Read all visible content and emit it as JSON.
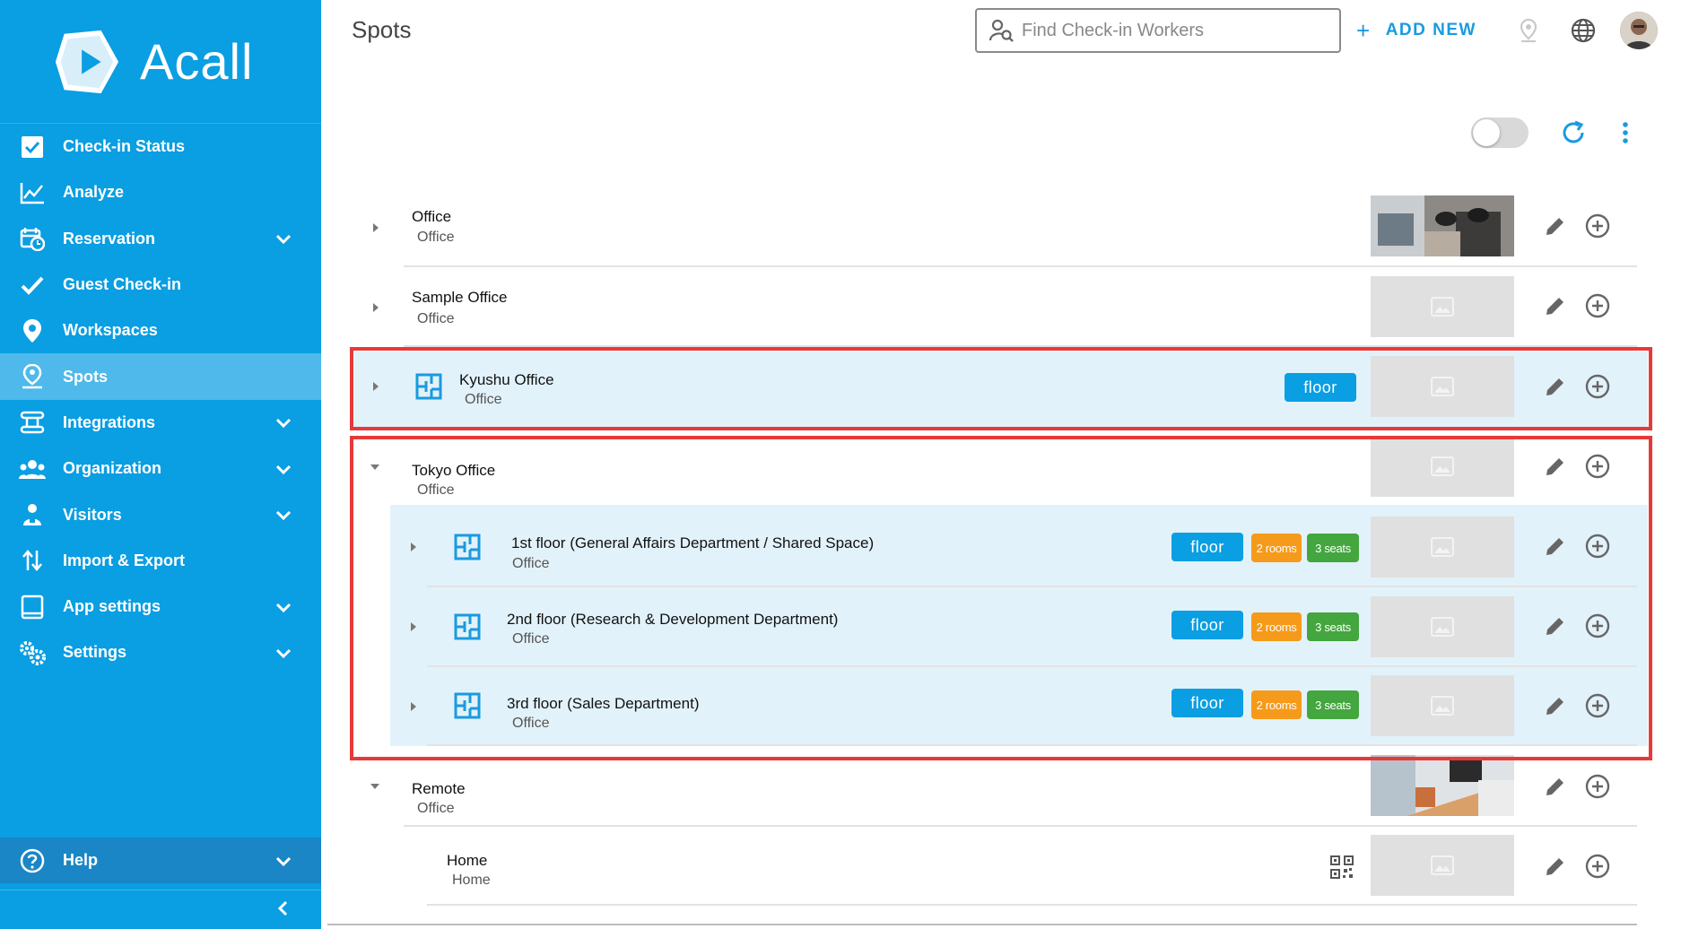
{
  "app": {
    "brand": "Acall",
    "brand_color": "#0a9ee2",
    "accent_color": "#1a9ae0",
    "highlight_frame_color": "#e6393a"
  },
  "sidebar": {
    "items": [
      {
        "label": "Check-in Status",
        "icon": "checkbox-icon",
        "has_chevron": false
      },
      {
        "label": "Analyze",
        "icon": "line-chart-icon",
        "has_chevron": false
      },
      {
        "label": "Reservation",
        "icon": "calendar-clock-icon",
        "has_chevron": true
      },
      {
        "label": "Guest Check-in",
        "icon": "checkmark-icon",
        "has_chevron": false
      },
      {
        "label": "Workspaces",
        "icon": "map-pin-icon",
        "has_chevron": false
      },
      {
        "label": "Spots",
        "icon": "person-pin-icon",
        "has_chevron": false,
        "active": true
      },
      {
        "label": "Integrations",
        "icon": "integrations-icon",
        "has_chevron": true
      },
      {
        "label": "Organization",
        "icon": "people-icon",
        "has_chevron": true
      },
      {
        "label": "Visitors",
        "icon": "visitor-icon",
        "has_chevron": true
      },
      {
        "label": "Import & Export",
        "icon": "import-export-icon",
        "has_chevron": false
      },
      {
        "label": "App settings",
        "icon": "tablet-icon",
        "has_chevron": true
      },
      {
        "label": "Settings",
        "icon": "gears-icon",
        "has_chevron": true
      }
    ],
    "help_label": "Help"
  },
  "header": {
    "title": "Spots",
    "search_placeholder": "Find Check-in Workers",
    "add_new_label": "ADD NEW"
  },
  "spots": {
    "office": {
      "name": "Office",
      "type": "Office"
    },
    "sample": {
      "name": "Sample Office",
      "type": "Office"
    },
    "kyushu": {
      "name": "Kyushu Office",
      "type": "Office",
      "badge": "floor"
    },
    "tokyo": {
      "name": "Tokyo Office",
      "type": "Office"
    },
    "floor1": {
      "name": "1st floor (General Affairs Department / Shared Space)",
      "type": "Office",
      "badge": "floor",
      "rooms": "2 rooms",
      "seats": "3 seats"
    },
    "floor2": {
      "name": "2nd floor (Research & Development Department)",
      "type": "Office",
      "badge": "floor",
      "rooms": "2 rooms",
      "seats": "3 seats"
    },
    "floor3": {
      "name": "3rd floor (Sales Department)",
      "type": "Office",
      "badge": "floor",
      "rooms": "2 rooms",
      "seats": "3 seats"
    },
    "remote": {
      "name": "Remote",
      "type": "Office"
    },
    "home": {
      "name": "Home",
      "type": "Home"
    }
  }
}
